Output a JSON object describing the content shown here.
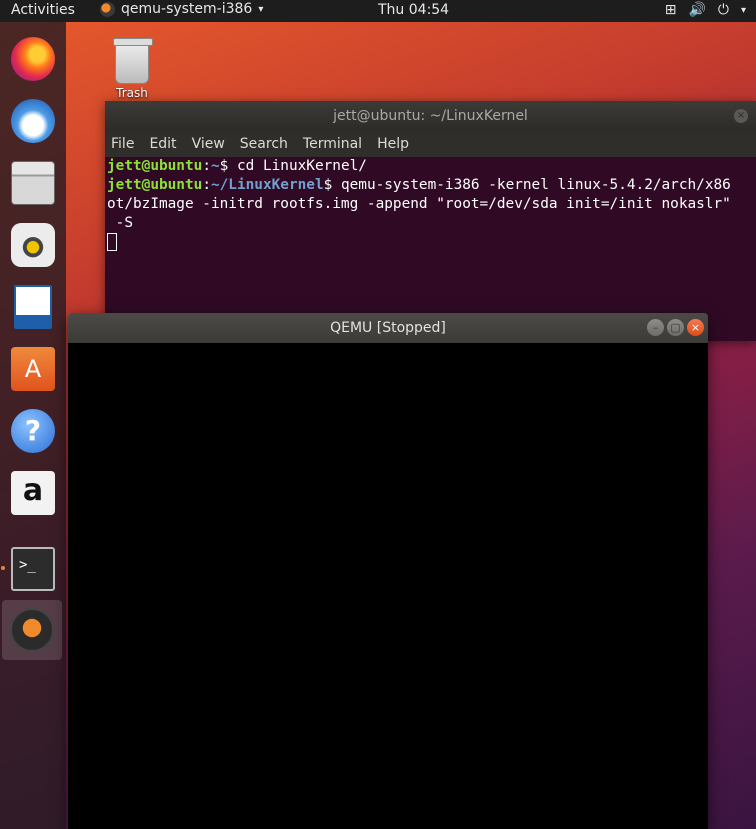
{
  "topbar": {
    "activities": "Activities",
    "app_name": "qemu-system-i386",
    "app_caret": "▾",
    "clock": "Thu 04:54",
    "network_icon": "⊞",
    "volume_icon": "🔊",
    "power_icon": "⏻",
    "tray_caret": "▾"
  },
  "dock": {
    "items": [
      {
        "name": "firefox"
      },
      {
        "name": "thunderbird"
      },
      {
        "name": "files"
      },
      {
        "name": "rhythmbox"
      },
      {
        "name": "libreoffice-writer"
      },
      {
        "name": "ubuntu-software"
      },
      {
        "name": "help"
      },
      {
        "name": "amazon"
      },
      {
        "name": "terminal"
      },
      {
        "name": "qemu"
      }
    ]
  },
  "desktop": {
    "trash_label": "Trash"
  },
  "terminal": {
    "title": "jett@ubuntu: ~/LinuxKernel",
    "close_glyph": "×",
    "menu": [
      "File",
      "Edit",
      "View",
      "Search",
      "Terminal",
      "Help"
    ],
    "lines": [
      {
        "user": "jett@ubuntu",
        "path": "~",
        "cmd": "$ cd LinuxKernel/"
      },
      {
        "user": "jett@ubuntu",
        "path": "~/LinuxKernel",
        "cmd": "$ qemu-system-i386 -kernel linux-5.4.2/arch/x86"
      }
    ],
    "wrap1": "ot/bzImage -initrd rootfs.img -append \"root=/dev/sda init=/init nokaslr\"",
    "wrap2": " -S"
  },
  "qemu": {
    "title": "QEMU [Stopped]",
    "min_glyph": "–",
    "max_glyph": "▢",
    "close_glyph": "×"
  },
  "colors": {
    "terminal_bg": "#300a24",
    "prompt_user": "#8ae234",
    "prompt_path": "#729fcf",
    "qemu_close": "#df4a16"
  }
}
